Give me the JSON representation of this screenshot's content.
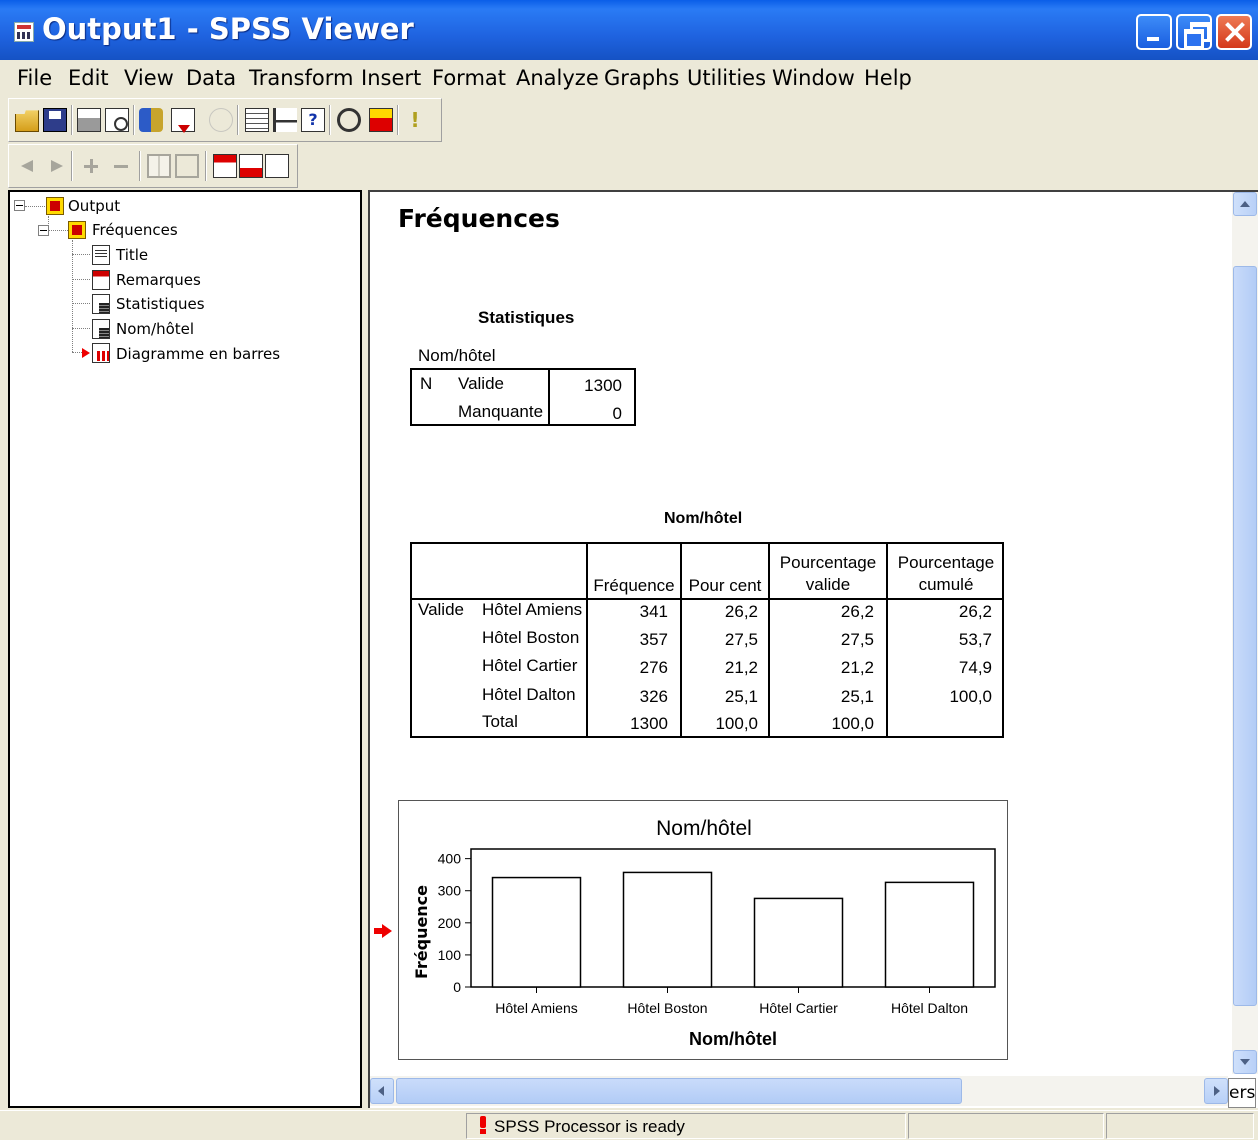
{
  "window": {
    "title": "Output1 - SPSS Viewer",
    "app_icon": "spss-viewer-icon",
    "controls": [
      "minimize-icon",
      "maximize-icon",
      "close-icon"
    ]
  },
  "menubar": {
    "items": [
      "File",
      "Edit",
      "View",
      "Data",
      "Transform",
      "Insert",
      "Format",
      "Analyze",
      "Graphs",
      "Utilities",
      "Window",
      "Help"
    ]
  },
  "toolbar_main": {
    "icons": [
      "open-icon",
      "save-icon",
      "print-icon",
      "print-preview-icon",
      "dialog-recall-icon",
      "goto-case-icon",
      "undo-icon",
      "table-icon",
      "variables-icon",
      "help-topics-icon",
      "circle-icon",
      "designate-window-icon",
      "exclamation-icon"
    ]
  },
  "toolbar_outline": {
    "icons": [
      "promote-left-icon",
      "demote-right-icon",
      "expand-plus-icon",
      "collapse-minus-icon",
      "show-icon",
      "hide-icon",
      "insert-heading-icon",
      "insert-title-icon",
      "insert-text-icon"
    ]
  },
  "outline": {
    "root": "Output",
    "group": "Fréquences",
    "items": [
      "Title",
      "Remarques",
      "Statistiques",
      "Nom/hôtel",
      "Diagramme en barres"
    ],
    "selected_item": "Diagramme en barres"
  },
  "content": {
    "heading": "Fréquences",
    "statistics": {
      "title": "Statistiques",
      "variable": "Nom/hôtel",
      "row_header": "N",
      "rows": [
        {
          "label": "Valide",
          "value": "1300"
        },
        {
          "label": "Manquante",
          "value": "0"
        }
      ]
    },
    "frequency_table": {
      "title": "Nom/hôtel",
      "headers": [
        "Fréquence",
        "Pour cent",
        "Pourcentage valide",
        "Pourcentage cumulé"
      ],
      "group_label": "Valide",
      "rows": [
        {
          "label": "Hôtel Amiens",
          "freq": "341",
          "pct": "26,2",
          "valid": "26,2",
          "cum": "26,2"
        },
        {
          "label": "Hôtel Boston",
          "freq": "357",
          "pct": "27,5",
          "valid": "27,5",
          "cum": "53,7"
        },
        {
          "label": "Hôtel Cartier",
          "freq": "276",
          "pct": "21,2",
          "valid": "21,2",
          "cum": "74,9"
        },
        {
          "label": "Hôtel Dalton",
          "freq": "326",
          "pct": "25,1",
          "valid": "25,1",
          "cum": "100,0"
        },
        {
          "label": "Total",
          "freq": "1300",
          "pct": "100,0",
          "valid": "100,0",
          "cum": ""
        }
      ]
    }
  },
  "chart_data": {
    "type": "bar",
    "title": "Nom/hôtel",
    "xlabel": "Nom/hôtel",
    "ylabel": "Fréquence",
    "categories": [
      "Hôtel Amiens",
      "Hôtel Boston",
      "Hôtel Cartier",
      "Hôtel Dalton"
    ],
    "values": [
      341,
      357,
      276,
      326
    ],
    "ylim": [
      0,
      430
    ],
    "yticks": [
      "0",
      "100",
      "200",
      "300",
      "400"
    ],
    "bar_fill": "#ffffff",
    "bar_stroke": "#000000",
    "grid": false,
    "legend": "none"
  },
  "statusbar": {
    "text": "SPSS Processor  is ready",
    "icon": "processor-ready-icon"
  },
  "pane_tab": {
    "label": "ers"
  },
  "colors": {
    "titlebar": "#1f63e0",
    "window_bg": "#ece9d8",
    "selection_arrow": "#e00000",
    "scrollbar": "#b8d0f7"
  }
}
